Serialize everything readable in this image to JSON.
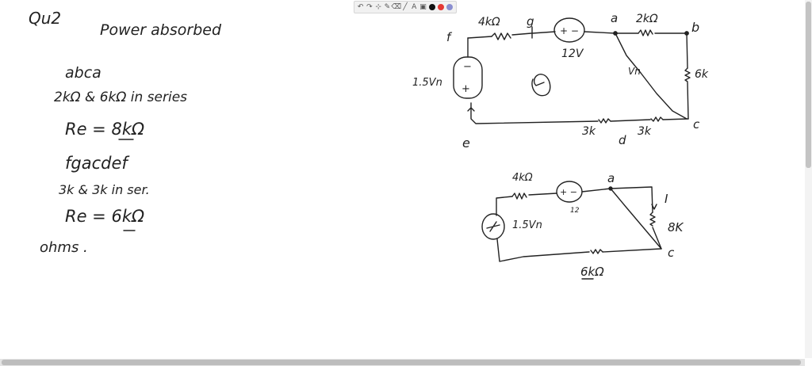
{
  "toolbar": {
    "undo_icon": "↶",
    "redo_icon": "↷",
    "select_icon": "⊹",
    "pen_icon": "✎",
    "eraser_icon": "⌫",
    "shape_icon": "╱",
    "text_icon": "A",
    "image_icon": "▣",
    "colors": [
      "#111111",
      "#e53935",
      "#8a8ed0"
    ]
  },
  "notes": {
    "heading": "Qu2",
    "title": "Power absorbed",
    "line1": "abca",
    "line2": "2kΩ  &  6kΩ  in series",
    "line3": "Re = 8kΩ",
    "line4": "fgacdef",
    "line5": "3k  &  3k  in ser.",
    "line6": "Re = 6kΩ",
    "line7": "ohms ."
  },
  "circuit1": {
    "r_fg": "4kΩ",
    "node_g": "g",
    "battery_sign": "+  −",
    "battery_value": "12V",
    "node_a": "a",
    "r_ab": "2kΩ",
    "node_b": "b",
    "node_f": "f",
    "src_value": "1.5Vn",
    "src_sign_top": "−",
    "src_sign_bottom": "+",
    "r_bc": "6k",
    "r_diag": "Vn",
    "node_c": "c",
    "node_e": "e",
    "r_cd": "3k",
    "node_d": "d",
    "r_de": "3k"
  },
  "circuit2": {
    "r_top": "4kΩ",
    "battery_sign": "+  −",
    "battery_value": "12",
    "node_a": "a",
    "current": "I",
    "r_right": "8K",
    "node_c": "c",
    "src_value": "1.5Vn",
    "r_bottom": "6kΩ"
  }
}
